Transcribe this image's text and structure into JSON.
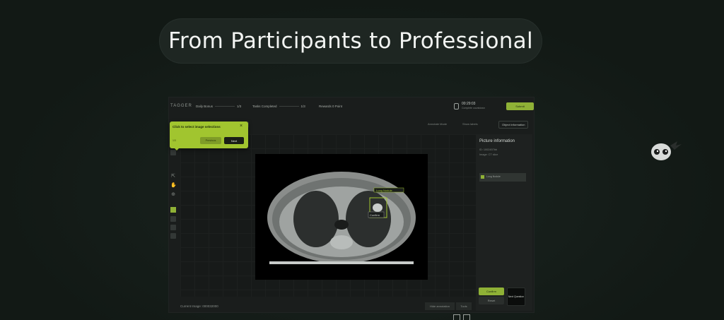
{
  "headline": "From Participants to Professional",
  "app": {
    "logo": "TAGGER",
    "stats": [
      {
        "label": "Daily Bonus",
        "value": "1/3"
      },
      {
        "label": "Tasks Completed",
        "value": "1/3"
      },
      {
        "label": "Rewards",
        "value": "0 Point"
      }
    ],
    "timer": {
      "value": "00:29:03",
      "sub": "Complete countdown"
    },
    "submit_label": "Submit",
    "toolbar": {
      "chip": "...",
      "right1": "Annotate Mode",
      "right2": "Show labels",
      "object_button": "Object information"
    },
    "popup": {
      "title": "Click to select image selections",
      "step": "1/3",
      "prev_label": "Previous",
      "next_label": "Next"
    },
    "annotation": {
      "box_label": "Lung Nodule",
      "box_tag": "Confirm"
    },
    "right_panel": {
      "title": "Picture information",
      "lines": [
        "ID: 1002457bb",
        "Image: CT slice"
      ],
      "item_label": "Lung Nodule",
      "confirm_label": "Confirm",
      "reset_label": "Reset",
      "dark_label": "Next Question"
    },
    "footer": {
      "current": "Current Image: 000032000",
      "btn1": "Hide annotation",
      "btn2": "Tools"
    }
  },
  "colors": {
    "accent": "#8fb136",
    "popup": "#a1c52f",
    "background": "#141b18"
  },
  "icons": [
    "lock-icon",
    "close-icon",
    "pointer-icon",
    "hand-icon",
    "zoom-icon",
    "mascot-icon"
  ]
}
